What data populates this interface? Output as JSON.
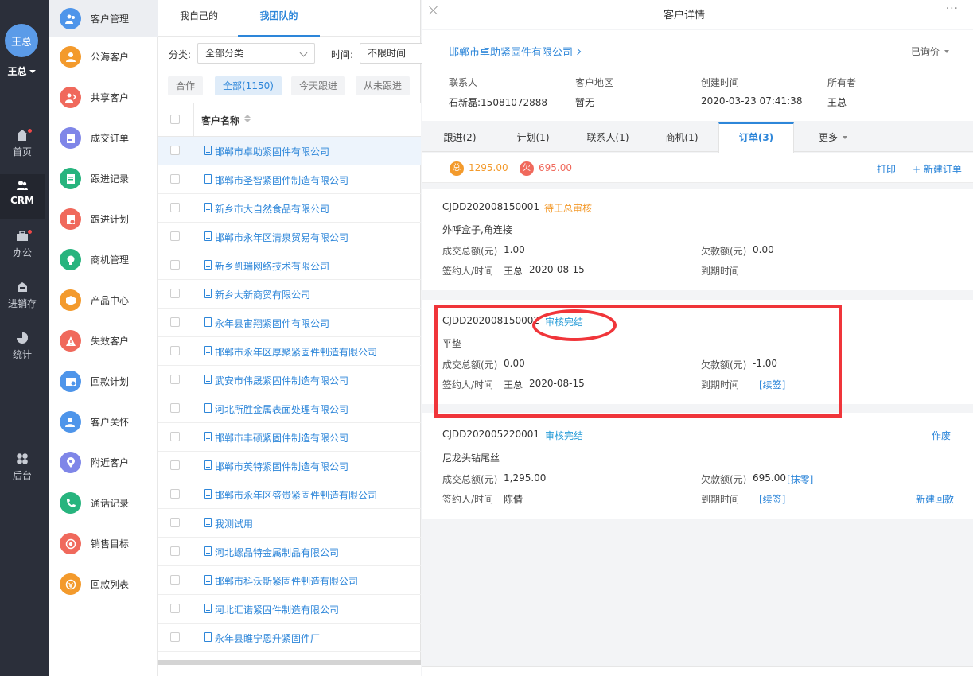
{
  "nav": {
    "avatar_text": "王总",
    "user_name": "王总",
    "items": [
      {
        "label": "首页",
        "icon": "home-icon",
        "dot": true
      },
      {
        "label": "CRM",
        "icon": "crm-icon",
        "dot": false
      },
      {
        "label": "办公",
        "icon": "office-icon",
        "dot": true
      },
      {
        "label": "进销存",
        "icon": "inventory-icon",
        "dot": false
      },
      {
        "label": "统计",
        "icon": "statistics-icon",
        "dot": false
      },
      {
        "label": "后台",
        "icon": "admin-icon",
        "dot": false
      }
    ]
  },
  "menu": {
    "items": [
      {
        "label": "客户管理",
        "icon": "customer-manage-icon",
        "color": "#4e95ea"
      },
      {
        "label": "公海客户",
        "icon": "public-customer-icon",
        "color": "#f39a2c"
      },
      {
        "label": "共享客户",
        "icon": "shared-customer-icon",
        "color": "#f0695c"
      },
      {
        "label": "成交订单",
        "icon": "order-icon",
        "color": "#7f86e8"
      },
      {
        "label": "跟进记录",
        "icon": "followup-record-icon",
        "color": "#27b47e"
      },
      {
        "label": "跟进计划",
        "icon": "followup-plan-icon",
        "color": "#f0695c"
      },
      {
        "label": "商机管理",
        "icon": "opportunity-icon",
        "color": "#27b47e"
      },
      {
        "label": "产品中心",
        "icon": "product-icon",
        "color": "#f39a2c"
      },
      {
        "label": "失效客户",
        "icon": "invalid-customer-icon",
        "color": "#f0695c"
      },
      {
        "label": "回款计划",
        "icon": "payment-plan-icon",
        "color": "#4e95ea"
      },
      {
        "label": "客户关怀",
        "icon": "customer-care-icon",
        "color": "#4e95ea"
      },
      {
        "label": "附近客户",
        "icon": "nearby-customer-icon",
        "color": "#7f86e8"
      },
      {
        "label": "通话记录",
        "icon": "call-record-icon",
        "color": "#27b47e"
      },
      {
        "label": "销售目标",
        "icon": "sales-target-icon",
        "color": "#f0695c"
      },
      {
        "label": "回款列表",
        "icon": "payment-list-icon",
        "color": "#f39a2c"
      }
    ]
  },
  "list": {
    "tabs": [
      "我自己的",
      "我团队的"
    ],
    "filter_category_label": "分类:",
    "filter_category_value": "全部分类",
    "filter_time_label": "时间:",
    "filter_time_value": "不限时间",
    "chips": [
      "合作",
      "全部(1150)",
      "今天跟进",
      "从未跟进"
    ],
    "column_header": "客户名称",
    "rows": [
      "邯郸市卓助紧固件有限公司",
      "邯郸市圣智紧固件制造有限公司",
      "新乡市大自然食品有限公司",
      "邯郸市永年区清泉贸易有限公司",
      "新乡凯瑞网络技术有限公司",
      "新乡大新商贸有限公司",
      "永年县宙翔紧固件有限公司",
      "邯郸市永年区厚聚紧固件制造有限公司",
      "武安市伟晟紧固件制造有限公司",
      "河北所胜金属表面处理有限公司",
      "邯郸市丰硕紧固件制造有限公司",
      "邯郸市英特紧固件制造有限公司",
      "邯郸市永年区盛贵紧固件制造有限公司",
      "我测试用",
      "河北螺品特金属制品有限公司",
      "邯郸市科沃斯紧固件制造有限公司",
      "河北汇诺紧固件制造有限公司",
      "永年县睢宁恩升紧固件厂"
    ]
  },
  "detail": {
    "title": "客户详情",
    "more": "···",
    "company": "邯郸市卓助紧固件有限公司",
    "status": "已询价",
    "meta": {
      "contact_label": "联系人",
      "contact_value": "石新磊:15081072888",
      "region_label": "客户地区",
      "region_value": "暂无",
      "created_label": "创建时间",
      "created_value": "2020-03-23 07:41:38",
      "owner_label": "所有者",
      "owner_value": "王总"
    },
    "tabs": [
      "跟进(2)",
      "计划(1)",
      "联系人(1)",
      "商机(1)",
      "订单(3)",
      "更多"
    ],
    "totals": {
      "total_badge": "总",
      "total_value": "1295.00",
      "owe_badge": "欠",
      "owe_value": "695.00",
      "print_label": "打印",
      "new_order_label": "+ 新建订单"
    },
    "orders": [
      {
        "code": "CJDD202008150001",
        "status": "待王总审核",
        "product": "外呼盒子,角连接",
        "amount_label": "成交总额(元)",
        "amount": "1.00",
        "owe_label": "欠款额(元)",
        "owe": "0.00",
        "signer_label": "签约人/时间",
        "signer": "王总",
        "date": "2020-08-15",
        "expire_label": "到期时间"
      },
      {
        "code": "CJDD202008150002",
        "status": "审核完结",
        "product": "平垫",
        "amount_label": "成交总额(元)",
        "amount": "0.00",
        "owe_label": "欠款额(元)",
        "owe": "-1.00",
        "signer_label": "签约人/时间",
        "signer": "王总",
        "date": "2020-08-15",
        "expire_label": "到期时间",
        "renew_label": "[续签]"
      },
      {
        "code": "CJDD202005220001",
        "status": "审核完结",
        "void_label": "作废",
        "product": "尼龙头钻尾丝",
        "amount_label": "成交总额(元)",
        "amount": "1,295.00",
        "owe_label": "欠款额(元)",
        "owe": "695.00",
        "writeoff_label": "[抹零]",
        "signer_label": "签约人/时间",
        "signer": "陈倩",
        "expire_label": "到期时间",
        "renew_label": "[续签]",
        "new_payment_label": "新建回款"
      }
    ]
  },
  "colors": {
    "accent": "#2d86d9",
    "pending": "#f39a2c",
    "done": "#2d9fd9",
    "annotation": "#f0353a"
  }
}
